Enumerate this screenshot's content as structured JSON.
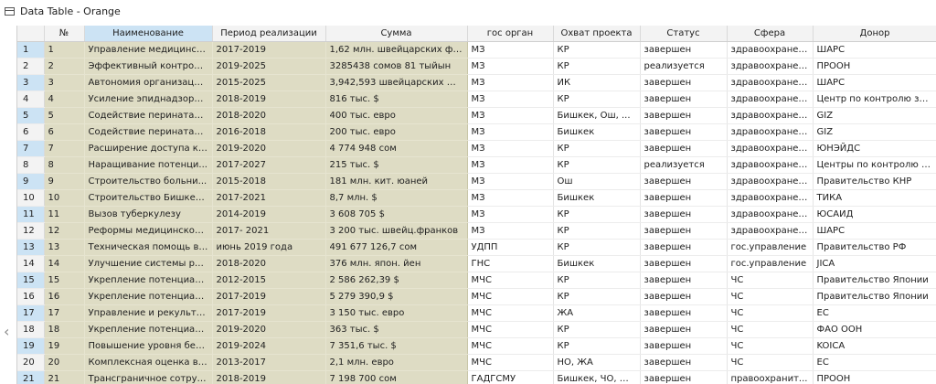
{
  "window": {
    "title": "Data Table - Orange"
  },
  "table": {
    "columns": [
      "№",
      "Наименование",
      "Период реализации",
      "Сумма",
      "гос орган",
      "Охват проекта",
      "Статус",
      "Сфера",
      "Донор"
    ],
    "rows": [
      [
        "1",
        "1",
        "Управление медицинск...",
        "2017-2019",
        "1,62 млн. швейцарских фр...",
        "МЗ",
        "КР",
        "завершен",
        "здравоохранен...",
        "ШАРС"
      ],
      [
        "2",
        "2",
        "Эффективный контрол...",
        "2019-2025",
        "3285438 сомов 81 тыйын",
        "МЗ",
        "КР",
        "реализуется",
        "здравоохранен...",
        "ПРООН"
      ],
      [
        "3",
        "3",
        "Автономия организаци...",
        "2015-2025",
        "3,942,593 швейцарских фр...",
        "МЗ",
        "ИК",
        "завершен",
        "здравоохранен...",
        "ШАРС"
      ],
      [
        "4",
        "4",
        "Усиление эпиднадзора ...",
        "2018-2019",
        "816 тыс. $",
        "МЗ",
        "КР",
        "завершен",
        "здравоохранен...",
        "Центр по контролю за ..."
      ],
      [
        "5",
        "5",
        "Содействие перинатал...",
        "2018-2020",
        "400 тыс. евро",
        "МЗ",
        "Бишкек, Ош, ...",
        "завершен",
        "здравоохранен...",
        "GIZ"
      ],
      [
        "6",
        "6",
        "Содействие перинатал...",
        "2016-2018",
        "200 тыс. евро",
        "МЗ",
        "Бишкек",
        "завершен",
        "здравоохранен...",
        "GIZ"
      ],
      [
        "7",
        "7",
        "Расширение доступа к ...",
        "2019-2020",
        "4 774 948 сом",
        "МЗ",
        "КР",
        "завершен",
        "здравоохранен...",
        "ЮНЭЙДС"
      ],
      [
        "8",
        "8",
        "Наращивание потенци...",
        "2017-2027",
        "215 тыс. $",
        "МЗ",
        "КР",
        "реализуется",
        "здравоохранен...",
        "Центры по контролю и..."
      ],
      [
        "9",
        "9",
        "Строительство больни...",
        "2015-2018",
        "181 млн. кит. юаней",
        "МЗ",
        "Ош",
        "завершен",
        "здравоохранен...",
        "Правительство КНР"
      ],
      [
        "10",
        "10",
        "Строительство Бишкек...",
        "2017-2021",
        "8,7 млн. $",
        "МЗ",
        "Бишкек",
        "завершен",
        "здравоохранен...",
        "ТИКА"
      ],
      [
        "11",
        "11",
        "Вызов туберкулезу",
        "2014-2019",
        "3 608 705 $",
        "МЗ",
        "КР",
        "завершен",
        "здравоохранен...",
        "ЮСАИД"
      ],
      [
        "12",
        "12",
        "Реформы медицинског...",
        "2017- 2021",
        "3 200 тыс. швейц.франков",
        "МЗ",
        "КР",
        "завершен",
        "здравоохранен...",
        "ШАРС"
      ],
      [
        "13",
        "13",
        "Техническая помощь в ...",
        "июнь 2019 года",
        "491 677 126,7 сом",
        "УДПП",
        "КР",
        "завершен",
        "гос.управление",
        "Правительство РФ"
      ],
      [
        "14",
        "14",
        "Улучшение системы ра...",
        "2018-2020",
        "376 млн. япон. йен",
        "ГНС",
        "Бишкек",
        "завершен",
        "гос.управление",
        "JICA"
      ],
      [
        "15",
        "15",
        "Укрепление потенциал...",
        "2012-2015",
        "2 586 262,39 $",
        "МЧС",
        "КР",
        "завершен",
        "ЧС",
        "Правительство Японии"
      ],
      [
        "16",
        "16",
        "Укрепление потенциал...",
        "2017-2019",
        "5 279 390,9 $",
        "МЧС",
        "КР",
        "завершен",
        "ЧС",
        "Правительство Японии"
      ],
      [
        "17",
        "17",
        "Управление и рекульти...",
        "2017-2019",
        "3 150 тыс. евро",
        "МЧС",
        "ЖА",
        "завершен",
        "ЧС",
        "ЕС"
      ],
      [
        "18",
        "18",
        "Укрепление потенциал...",
        "2019-2020",
        "363 тыс. $",
        "МЧС",
        "КР",
        "завершен",
        "ЧС",
        "ФАО ООН"
      ],
      [
        "19",
        "19",
        "Повышение уровня без...",
        "2019-2024",
        "7 351,6 тыс. $",
        "МЧС",
        "КР",
        "завершен",
        "ЧС",
        "KOICA"
      ],
      [
        "20",
        "20",
        "Комплексная оценка во...",
        "2013-2017",
        "2,1 млн. евро",
        "МЧС",
        "НО, ЖА",
        "завершен",
        "ЧС",
        "ЕС"
      ],
      [
        "21",
        "21",
        "Трансграничное сотруд...",
        "2018-2019",
        "7 198 700 сом",
        "ГАДГСМУ",
        "Бишкек, ЧО, Ж...",
        "завершен",
        "правоохранит...",
        "ПРООН"
      ]
    ]
  },
  "icons": {
    "window": "table-icon",
    "scroll": "chevron-left-icon"
  },
  "colors": {
    "header_highlight": "#cce3f4",
    "meta_column_bg": "#dedcc4"
  }
}
